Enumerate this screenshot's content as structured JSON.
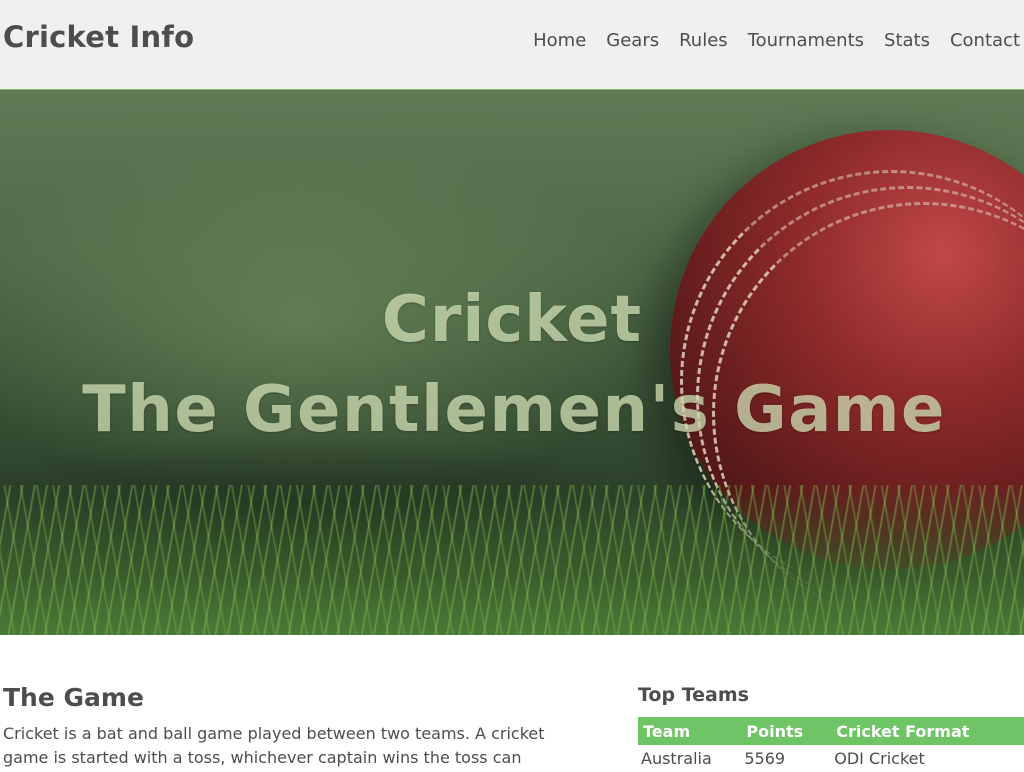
{
  "header": {
    "brand": "Cricket Info",
    "nav": [
      "Home",
      "Gears",
      "Rules",
      "Tournaments",
      "Stats",
      "Contact"
    ]
  },
  "hero": {
    "line1": "Cricket",
    "line2": "The Gentlemen's Game"
  },
  "game": {
    "title": "The Game",
    "text": "Cricket is a bat and ball game played between two teams. A cricket game is started with a toss, whichever captain wins the toss can"
  },
  "top_teams": {
    "title": "Top Teams",
    "headers": [
      "Team",
      "Points",
      "Cricket Format"
    ],
    "rows": [
      [
        "Australia",
        "5569",
        "ODI Cricket"
      ]
    ]
  },
  "colors": {
    "accent": "#6fc466",
    "header_bg": "#f0f0ee",
    "text": "#4d4d4d"
  }
}
